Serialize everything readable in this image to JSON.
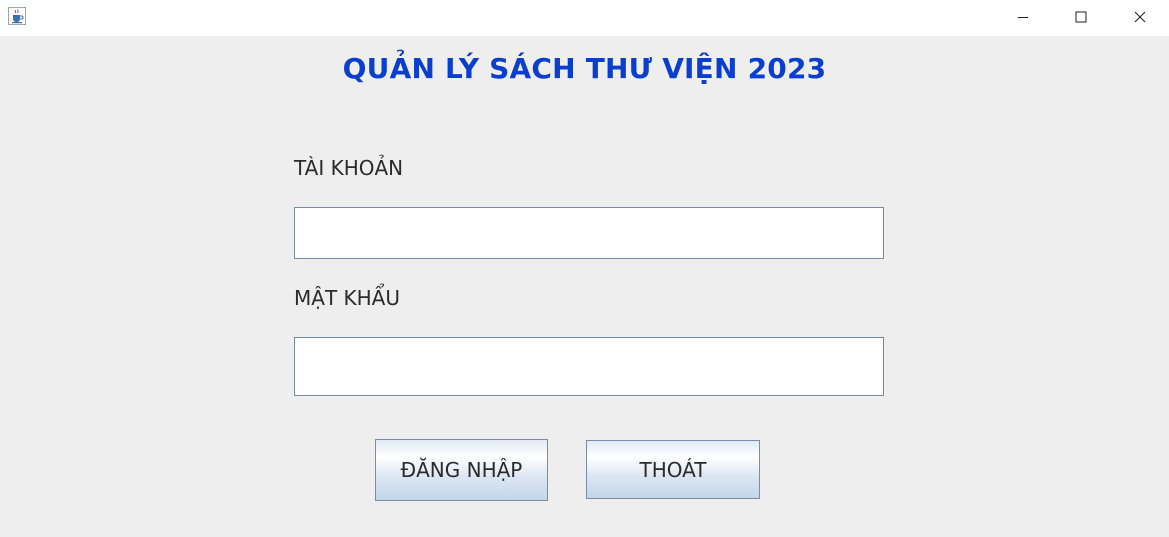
{
  "window": {
    "icon": "java-cup-icon",
    "controls": {
      "minimize": "minimize-icon",
      "maximize": "maximize-icon",
      "close": "close-icon"
    }
  },
  "form": {
    "title": "QUẢN LÝ SÁCH THƯ VIỆN 2023",
    "username_label": "TÀI KHOẢN",
    "username_value": "",
    "password_label": "MẬT KHẨU",
    "password_value": "",
    "login_button": "ĐĂNG NHẬP",
    "exit_button": "THOÁT"
  },
  "colors": {
    "title": "#0a3ed1",
    "background": "#eeeeee"
  }
}
